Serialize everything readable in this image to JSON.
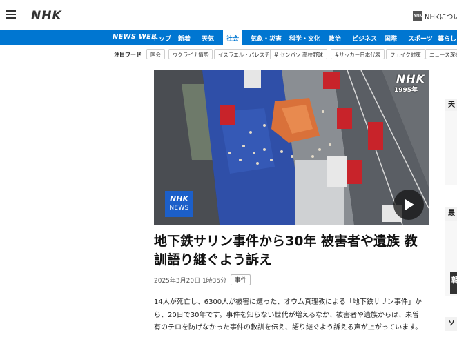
{
  "header": {
    "logo": "NHK",
    "about": "NHKについて",
    "about_icon": "NHK"
  },
  "nav": {
    "brand": "NEWS WEB",
    "items": [
      "トップ",
      "新着",
      "天気",
      "社会",
      "気象・災害",
      "科学・文化",
      "政治",
      "ビジネス",
      "国際",
      "スポーツ",
      "暮らし"
    ],
    "active": "社会",
    "accent": "#0076d1"
  },
  "keywords": {
    "label": "注目ワード",
    "tags": [
      "国会",
      "ウクライナ情勢",
      "イスラエル・パレスチナ",
      "# センバツ 高校野球",
      "#サッカー日本代表",
      "フェイク対策",
      "ニュース深掘"
    ]
  },
  "video": {
    "watermark": "NHK",
    "year": "1995年",
    "badge_line1": "NHK",
    "badge_line2": "NEWS",
    "play_icon": "play-icon"
  },
  "article": {
    "title": "地下鉄サリン事件から30年 被害者や遺族 教訓語り継ぐよう訴え",
    "date": "2025年3月20日 1時35分",
    "category": "事件",
    "body": "14人が死亡し、6300人が被害に遭った、オウム真理教による「地下鉄サリン事件」から、20日で30年です。事件を知らない世代が増えるなか、被害者や遺族からは、未曽有のテロを防げなかった事件の教訓を伝え、語り継ぐよう訴える声が上がっています。"
  },
  "sidebar": {
    "fragments": [
      "天",
      "最",
      "韓",
      "ソ"
    ]
  }
}
